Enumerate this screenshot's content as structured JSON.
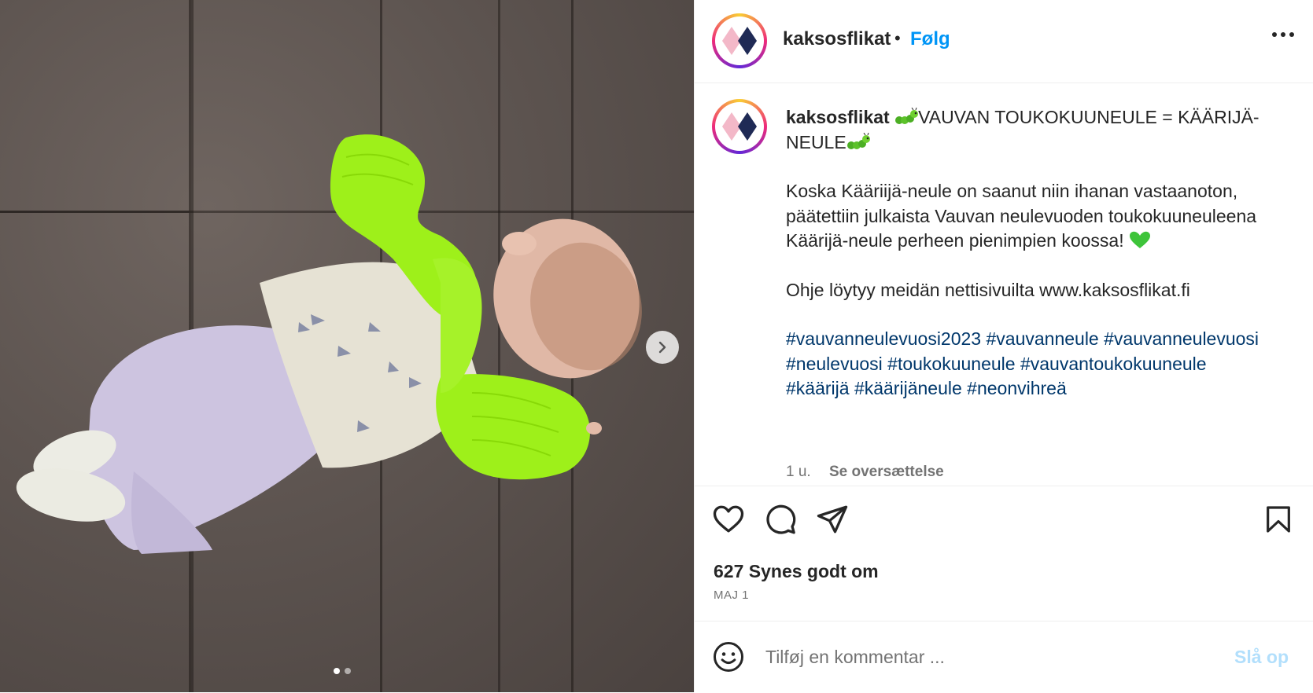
{
  "post": {
    "username": "kaksosflikat",
    "separator": "•",
    "follow_label": "Følg",
    "caption": {
      "username": "kaksosflikat",
      "title_line": "VAUVAN TOUKOKUUNEULE = KÄÄRIJÄ-NEULE",
      "paragraph1": "Koska Kääriijä-neule on saanut niin ihanan vastaanoton, päätettiin julkaista Vauvan neulevuoden toukokuuneuleena Käärijä-neule perheen pienimpien koossa!",
      "paragraph2": "Ohje löytyy meidän nettisivuilta www.kaksosflikat.fi",
      "hashtags": [
        "#vauvanneulevuosi2023",
        "#vauvanneule",
        "#vauvanneulevuosi",
        "#neulevuosi",
        "#toukokuuneule",
        "#vauvantoukokuuneule",
        "#käärijä",
        "#käärijäneule",
        "#neonvihreä"
      ]
    },
    "time_ago": "1 u.",
    "translate_label": "Se oversættelse",
    "likes": "627 Synes godt om",
    "date": "MAJ 1",
    "comment_placeholder": "Tilføj en kommentar ...",
    "post_label": "Slå op"
  },
  "icons": {
    "more": "more-options-icon",
    "like": "heart-icon",
    "comment": "comment-icon",
    "share": "send-icon",
    "save": "bookmark-icon",
    "emoji": "emoji-icon",
    "next": "chevron-right-icon"
  },
  "carousel": {
    "slides": 2,
    "current": 1
  },
  "colors": {
    "accent": "#0095f6",
    "hashtag": "#00376b",
    "muted": "#737373",
    "sweater": "#9ef01a"
  }
}
